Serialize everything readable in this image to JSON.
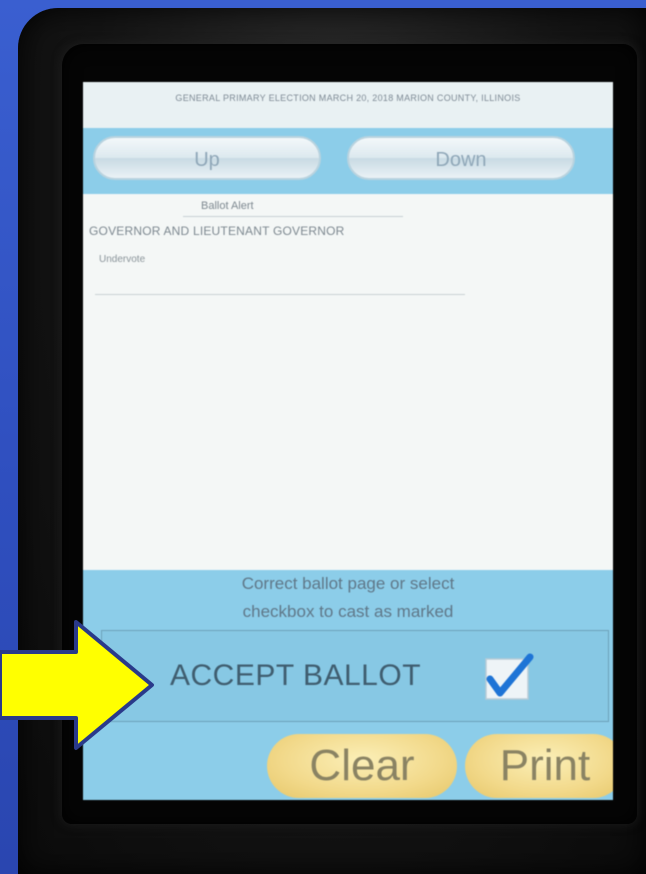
{
  "screen": {
    "header": "GENERAL PRIMARY ELECTION MARCH 20, 2018 MARION COUNTY, ILLINOIS",
    "nav": {
      "up_label": "Up",
      "down_label": "Down"
    },
    "alert": {
      "title": "Ballot Alert",
      "race": "GOVERNOR AND LIEUTENANT GOVERNOR",
      "status": "Undervote"
    },
    "instructions": {
      "line1": "Correct ballot page or select",
      "line2": "checkbox to cast as marked"
    },
    "accept": {
      "label": "ACCEPT BALLOT",
      "checked": true
    },
    "buttons": {
      "clear_label": "Clear",
      "print_label": "Print"
    }
  },
  "colors": {
    "background_blue": "#2f4fbf",
    "screen_blue": "#8ccde9",
    "arrow_yellow": "#ffff00",
    "button_gold": "#f2d98a",
    "check_blue": "#1e74d6"
  },
  "icons": {
    "arrow": "right-arrow-icon",
    "checkbox": "checkmark-icon"
  }
}
